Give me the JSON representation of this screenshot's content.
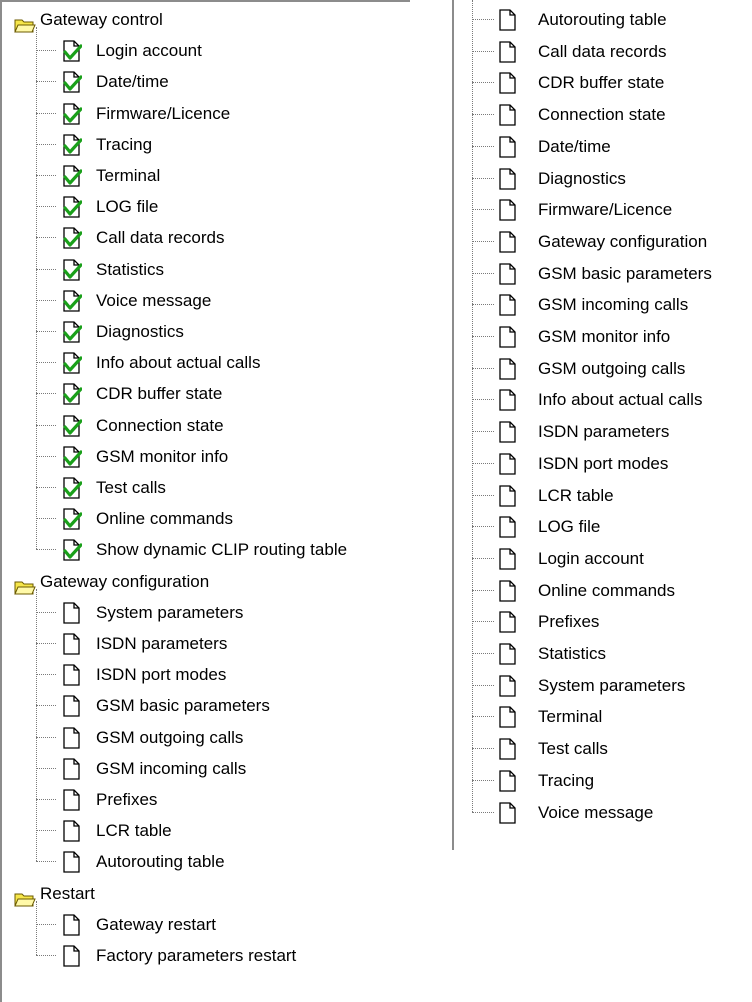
{
  "left_tree": [
    {
      "label": "Gateway control",
      "icon": "folder-open-icon",
      "child_icon": "checked-page-icon",
      "children": [
        "Login account",
        "Date/time",
        "Firmware/Licence",
        "Tracing",
        "Terminal",
        "LOG file",
        "Call data records",
        "Statistics",
        "Voice message",
        "Diagnostics",
        "Info about actual calls",
        "CDR buffer state",
        "Connection state",
        "GSM monitor info",
        "Test calls",
        "Online commands",
        "Show dynamic CLIP routing table"
      ]
    },
    {
      "label": "Gateway configuration",
      "icon": "folder-open-icon",
      "child_icon": "page-icon",
      "children": [
        "System parameters",
        "ISDN parameters",
        "ISDN port modes",
        "GSM basic parameters",
        "GSM outgoing calls",
        "GSM incoming calls",
        "Prefixes",
        "LCR table",
        "Autorouting table"
      ]
    },
    {
      "label": "Restart",
      "icon": "folder-open-icon",
      "child_icon": "page-icon",
      "children": [
        "Gateway restart",
        "Factory parameters restart"
      ]
    }
  ],
  "right_list": [
    "Autorouting table",
    "Call data records",
    "CDR buffer state",
    "Connection state",
    "Date/time",
    "Diagnostics",
    "Firmware/Licence",
    "Gateway configuration",
    "GSM basic parameters",
    "GSM incoming calls",
    "GSM monitor info",
    "GSM outgoing calls",
    "Info about actual calls",
    "ISDN parameters",
    "ISDN port modes",
    "LCR table",
    "LOG file",
    "Login account",
    "Online commands",
    "Prefixes",
    "Statistics",
    "System parameters",
    "Terminal",
    "Test calls",
    "Tracing",
    "Voice message"
  ],
  "colors": {
    "folder": "#f6e64a",
    "check": "#1aa01a",
    "tree_line": "#7a7a7a"
  }
}
